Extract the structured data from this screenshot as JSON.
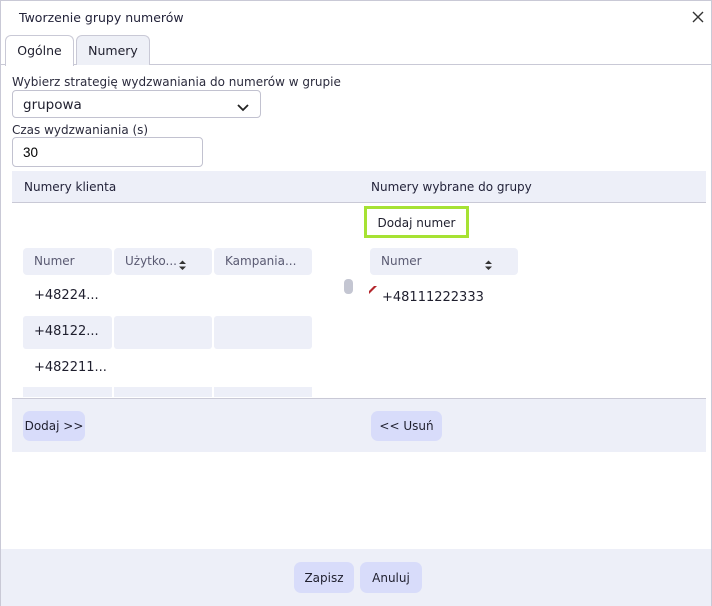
{
  "dialog": {
    "title": "Tworzenie grupy numerów"
  },
  "tabs": [
    {
      "label": "Ogólne",
      "active": true
    },
    {
      "label": "Numery",
      "active": false
    }
  ],
  "form": {
    "strategy_label": "Wybierz strategię wydzwaniania do numerów w grupie",
    "strategy_value": "grupowa",
    "time_label": "Czas wydzwaniania (s)",
    "time_value": "30"
  },
  "client_numbers": {
    "header": "Numery klienta",
    "columns": [
      "Numer",
      "Użytko...",
      "Kampania..."
    ],
    "rows": [
      [
        "+48224...",
        "",
        ""
      ],
      [
        "+48122...",
        "",
        ""
      ],
      [
        "+482211...",
        "",
        ""
      ]
    ],
    "add_button": "Dodaj >>"
  },
  "selected_numbers": {
    "header": "Numery wybrane do grupy",
    "add_number_button": "Dodaj numer",
    "columns": [
      "Numer"
    ],
    "rows": [
      [
        "+48111222333"
      ]
    ],
    "remove_button": "<< Usuń"
  },
  "footer": {
    "save": "Zapisz",
    "cancel": "Anuluj"
  },
  "colors": {
    "accent_button": "#d8dcfa",
    "highlight_border": "#a6e233",
    "panel_bg": "#edeff8"
  },
  "icons": {
    "close": "close-icon",
    "dropdown": "chevron-down-icon",
    "sort": "sort-icon"
  }
}
